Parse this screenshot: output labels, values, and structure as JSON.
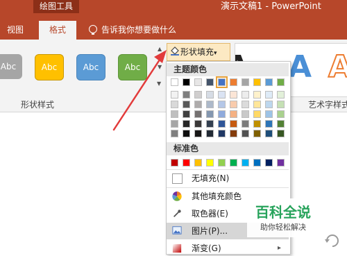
{
  "window": {
    "context_tab": "绘图工具",
    "title": "演示文稿1 - PowerPoint"
  },
  "ribbon_tabs": {
    "view": "视图",
    "format": "格式",
    "tell_me": "告诉我你想要做什么"
  },
  "shape_styles": {
    "swatches": [
      "Abc",
      "Abc",
      "Abc",
      "Abc"
    ],
    "group_label": "形状样式"
  },
  "shape_fill": {
    "label": "形状填充",
    "dropdown_arrow": "▾"
  },
  "art_styles": {
    "group_label": "艺术字样式",
    "gallery_letter": "A"
  },
  "dropdown": {
    "theme_colors_title": "主题颜色",
    "standard_colors_title": "标准色",
    "no_fill": "无填充(N)",
    "more_colors": "其他填充颜色",
    "eyedropper": "取色器(E)",
    "picture": "图片(P)...",
    "gradient": "渐变(G)",
    "submenu_arrow": "▸"
  },
  "theme_colors": {
    "rows": [
      [
        "#ffffff",
        "#000000",
        "#e7e6e6",
        "#44546a",
        "#4472c4",
        "#ed7d31",
        "#a5a5a5",
        "#ffc000",
        "#5b9bd5",
        "#70ad47"
      ],
      [
        "#f2f2f2",
        "#7f7f7f",
        "#d0cece",
        "#d6dce5",
        "#dae3f3",
        "#fbe5d6",
        "#ededed",
        "#fff2cc",
        "#deebf7",
        "#e2f0d9"
      ],
      [
        "#d9d9d9",
        "#595959",
        "#aeabab",
        "#adb9ca",
        "#b4c7e7",
        "#f8cbad",
        "#dbdbdb",
        "#ffe699",
        "#bdd7ee",
        "#c5e0b4"
      ],
      [
        "#bfbfbf",
        "#404040",
        "#757171",
        "#8497b0",
        "#8faadc",
        "#f4b183",
        "#c9c9c9",
        "#ffd966",
        "#9dc3e6",
        "#a9d18e"
      ],
      [
        "#a6a6a6",
        "#262626",
        "#3a3838",
        "#333f50",
        "#2f5597",
        "#c55a11",
        "#7b7b7b",
        "#bf9000",
        "#2e75b6",
        "#538135"
      ],
      [
        "#7f7f7f",
        "#0d0d0d",
        "#171616",
        "#222a35",
        "#203864",
        "#843c0c",
        "#525252",
        "#7f6000",
        "#1f4e79",
        "#385723"
      ]
    ],
    "selected": "#4472c4"
  },
  "standard_colors": [
    "#c00000",
    "#ff0000",
    "#ffc000",
    "#ffff00",
    "#92d050",
    "#00b050",
    "#00b0f0",
    "#0070c0",
    "#002060",
    "#7030a0"
  ],
  "watermark": {
    "title": "百科全说",
    "subtitle": "助你轻松解决"
  }
}
